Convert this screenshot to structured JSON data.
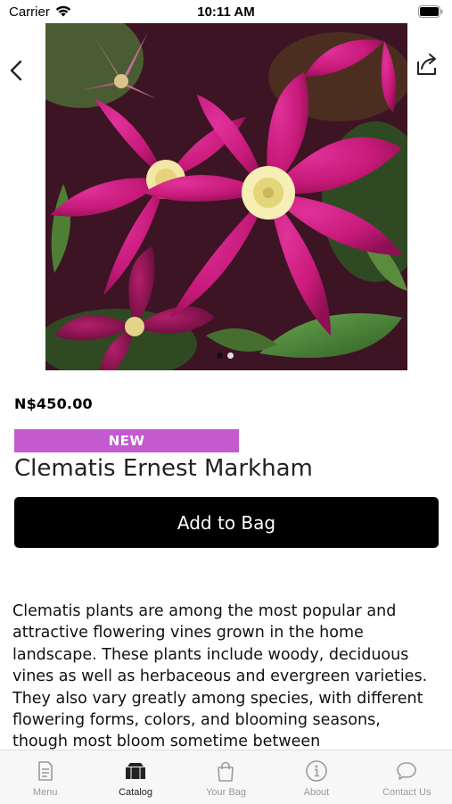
{
  "status_bar": {
    "carrier": "Carrier",
    "time": "10:11 AM"
  },
  "product": {
    "price": "N$450.00",
    "badge": "NEW",
    "badge_color": "#c459d0",
    "title": "Clematis Ernest Markham",
    "add_to_bag_label": "Add to Bag",
    "description": "Clematis plants are among the most popular and attractive flowering vines grown in the home landscape. These plants include woody, deciduous vines as well as herbaceous and evergreen varieties. They also vary greatly among species, with different flowering forms, colors, and blooming seasons, though most bloom sometime between",
    "image_pages": 2,
    "image_current_page": 1,
    "image_subject": "magenta clematis flowers"
  },
  "navigation": {
    "back_icon": "chevron-left-icon",
    "share_icon": "share-icon"
  },
  "tabs": [
    {
      "label": "Menu",
      "icon": "menu-icon",
      "active": false
    },
    {
      "label": "Catalog",
      "icon": "catalog-icon",
      "active": true
    },
    {
      "label": "Your Bag",
      "icon": "bag-icon",
      "active": false
    },
    {
      "label": "About",
      "icon": "info-icon",
      "active": false
    },
    {
      "label": "Contact Us",
      "icon": "chat-bubble-icon",
      "active": false
    }
  ]
}
